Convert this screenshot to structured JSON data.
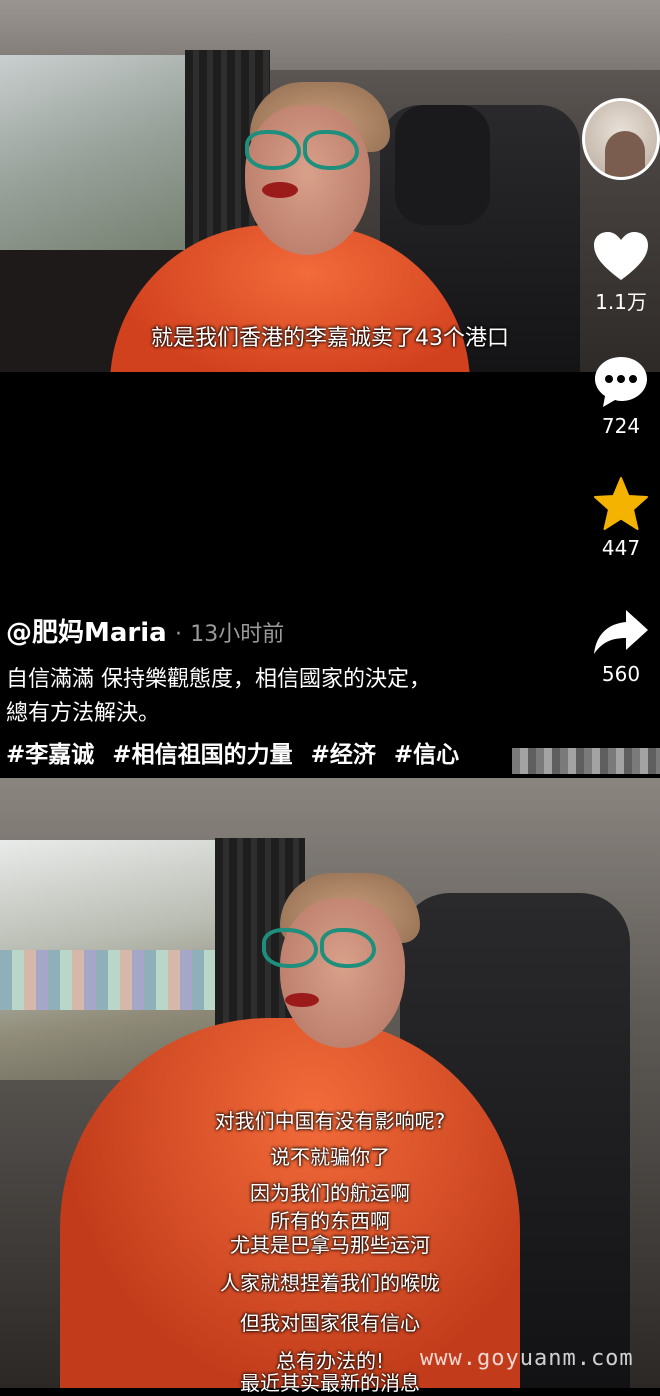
{
  "video_top": {
    "subtitle": "就是我们香港的李嘉诚卖了43个港口"
  },
  "actions": {
    "avatar_icon": "creator-avatar",
    "like": {
      "icon": "heart-icon",
      "count": "1.1万"
    },
    "comment": {
      "icon": "comment-icon",
      "count": "724"
    },
    "favorite": {
      "icon": "star-icon",
      "count": "447",
      "color": "#f5b301"
    },
    "share": {
      "icon": "share-icon",
      "count": "560"
    }
  },
  "caption": {
    "author": "@肥妈Maria",
    "separator": "·",
    "time": "13小时前",
    "description_line1": "自信滿滿 保持樂觀態度，相信國家的決定，",
    "description_line2": "總有方法解決。",
    "tags": [
      "#李嘉诚",
      "#相信祖国的力量",
      "#经济",
      "#信心"
    ]
  },
  "video_bottom": {
    "subtitles": [
      "对我们中国有没有影响呢?",
      "说不就骗你了",
      "因为我们的航运啊",
      "所有的东西啊",
      "尤其是巴拿马那些运河",
      "人家就想捏着我们的喉咙",
      "但我对国家很有信心",
      "总有办法的!",
      "最近其实最新的消息"
    ]
  },
  "watermark": "www.goyuanm.com"
}
